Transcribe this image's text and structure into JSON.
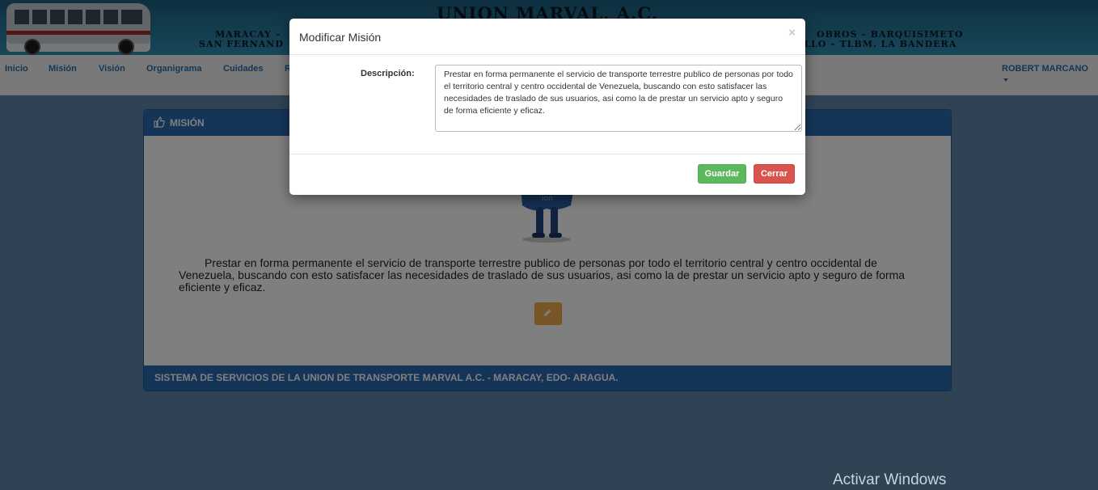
{
  "banner": {
    "title": "UNION MARVAL, A.C.",
    "line1_left": "MARACAY –",
    "line2_left": "SAN FERNAND",
    "line1_right": "OBROS – BARQUISIMETO",
    "line2_right": "ELLO – TLBM. LA BANDERA"
  },
  "nav": {
    "items": [
      "Inicio",
      "Misión",
      "Visión",
      "Organigrama",
      "Cuidades",
      "R"
    ],
    "user": "ROBERT MARCANO"
  },
  "panel": {
    "heading": "MISIÓN",
    "mission_text": "Prestar en forma permanente el servicio de transporte terrestre publico de personas por todo el territorio central y centro occidental de Venezuela, buscando con esto satisfacer las necesidades de traslado de sus usuarios, asi como la de prestar un servicio apto y seguro de forma eficiente y eficaz.",
    "footer": "SISTEMA DE SERVICIOS DE LA UNION DE TRANSPORTE MARVAL A.C. - MARACAY, EDO- ARAGUA."
  },
  "modal": {
    "title": "Modificar Misión",
    "close_symbol": "×",
    "description_label": "Descripción:",
    "description_value": "Prestar en forma permanente el servicio de transporte terrestre publico de personas por todo el territorio central y centro occidental de Venezuela, buscando con esto satisfacer las necesidades de traslado de sus usuarios, asi como la de prestar un servicio apto y seguro de forma eficiente y eficaz.",
    "save_label": "Guardar",
    "cancel_label": "Cerrar"
  },
  "watermark": "Activar Windows",
  "colors": {
    "primary": "#2a6ab0",
    "success": "#5cb85c",
    "danger": "#d9534f",
    "warning": "#f0ad4e"
  },
  "icons": {
    "panel_heading": "thumbs-up-icon",
    "edit": "pencil-icon",
    "close": "close-icon"
  }
}
